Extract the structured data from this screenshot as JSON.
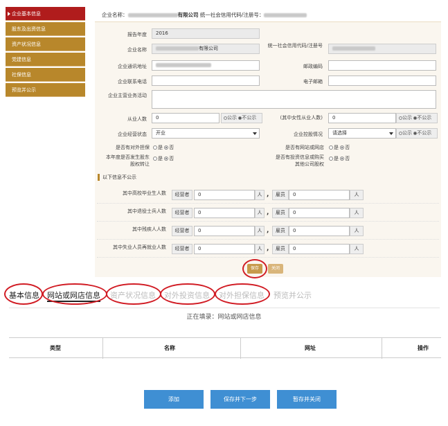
{
  "sidebar": {
    "items": [
      {
        "label": "企业基本信息",
        "active": true
      },
      {
        "label": "股东及出资信息",
        "active": false
      },
      {
        "label": "资产状况信息",
        "active": false
      },
      {
        "label": "党建信息",
        "active": false
      },
      {
        "label": "社保信息",
        "active": false
      },
      {
        "label": "预览并公示",
        "active": false
      }
    ]
  },
  "header": {
    "company_label": "企业名称：",
    "company_suffix": "有限公司",
    "code_label": "统一社会信用代码/注册号："
  },
  "form": {
    "year_label": "报告年度",
    "year_value": "2016",
    "name_label": "企业名称",
    "name_suffix": "有限公司",
    "credit_label": "统一社会信用代码/注册号",
    "address_label": "企业通讯地址",
    "postcode_label": "邮政编码",
    "phone_label": "企业联系电话",
    "email_label": "电子邮箱",
    "business_label": "企业主营业务活动",
    "employees_label": "从业人数",
    "employees_value": "0",
    "female_label": "(其中女性从业人数)",
    "female_value": "0",
    "pub_options": [
      "公示",
      "不公示"
    ],
    "status_label": "企业经营状态",
    "status_value": "开业",
    "holding_label": "企业控股情况",
    "holding_value": "请选择",
    "guarantee_label": "是否有对外担保",
    "website_label": "是否有网站或网店",
    "transfer_label": "本年度是否发生股东股权转让",
    "invest_label": "是否有投资信息或购买其他公司股权",
    "yes": "是",
    "no": "否"
  },
  "hidden_section": {
    "title": "以下信息不公示",
    "rows": [
      {
        "label": "其中高校毕业生人数"
      },
      {
        "label": "其中退役士兵人数"
      },
      {
        "label": "其中残疾人人数"
      },
      {
        "label": "其中失业人员再就业人数"
      }
    ],
    "manager_label": "经营者",
    "employee_label": "雇员",
    "unit": "人",
    "value": "0",
    "comma": ","
  },
  "form_buttons": {
    "save": "保存",
    "close": "关闭"
  },
  "tabs": [
    {
      "label": "基本信息"
    },
    {
      "label": "网站或网店信息"
    },
    {
      "label": "资产状况信息"
    },
    {
      "label": "对外投资信息"
    },
    {
      "label": "对外担保信息"
    },
    {
      "label": "预览并公示"
    }
  ],
  "filling": "正在填录：网站或网店信息",
  "table": {
    "headers": [
      "类型",
      "名称",
      "网址",
      "操作"
    ]
  },
  "bottom_buttons": {
    "add": "添加",
    "save_next": "保存并下一步",
    "save_close": "暂存并关闭"
  },
  "colors": {
    "sidebar": "#b8872b",
    "sidebar_active": "#b01c1c",
    "annotation": "#d11c24",
    "primary_button": "#3f8fd3"
  }
}
